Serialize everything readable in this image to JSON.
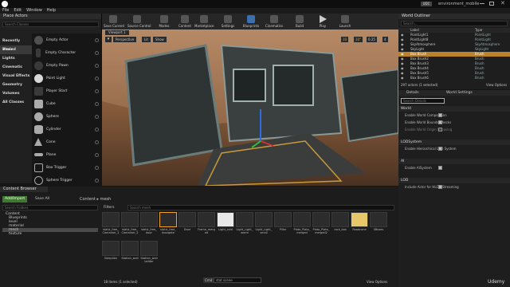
{
  "title_bar": {
    "project": "environment_mobile",
    "badge": "UDC"
  },
  "menu": [
    "File",
    "Edit",
    "Window",
    "Help"
  ],
  "place_actors": {
    "tab": "Place Actors",
    "search_placeholder": "Search Classes",
    "categories": [
      "Recently Placed",
      "Basic",
      "Lights",
      "Cinematic",
      "Visual Effects",
      "Geometry",
      "Volumes",
      "All Classes"
    ],
    "actors": [
      "Empty Actor",
      "Empty Character",
      "Empty Pawn",
      "Point Light",
      "Player Start",
      "Cube",
      "Sphere",
      "Cylinder",
      "Cone",
      "Plane",
      "Box Trigger",
      "Sphere Trigger"
    ]
  },
  "toolbar": [
    "Save Current",
    "Source Control",
    "Modes",
    "Content",
    "Marketplace",
    "Settings",
    "Blueprints",
    "Cinematics",
    "Build",
    "Play",
    "Launch"
  ],
  "viewport": {
    "tab": "Viewport 1",
    "mode": "Perspective",
    "lit": "Lit",
    "show": "Show",
    "grid": "10",
    "angle": "10°",
    "scale": "0.25",
    "cam": "4"
  },
  "outliner": {
    "title": "World Outliner",
    "search_placeholder": "Search...",
    "headers": [
      "Label",
      "Type"
    ],
    "rows": [
      {
        "label": "PointLight1",
        "type": "PointLight"
      },
      {
        "label": "PointLight8",
        "type": "PointLight"
      },
      {
        "label": "SkyAtmosphere",
        "type": "SkyAtmosphere"
      },
      {
        "label": "SkyLight",
        "type": "SkyLight"
      },
      {
        "label": "Box Brush",
        "type": "Brush"
      },
      {
        "label": "Box Brush2",
        "type": "Brush"
      },
      {
        "label": "Box Brush3",
        "type": "Brush"
      },
      {
        "label": "Box Brush4",
        "type": "Brush"
      },
      {
        "label": "Box Brush5",
        "type": "Brush"
      },
      {
        "label": "Box Brush6",
        "type": "Brush"
      }
    ],
    "count": "297 actors (1 selected)",
    "view_options": "View Options"
  },
  "details": {
    "tabs": [
      "Details",
      "World Settings"
    ],
    "search_placeholder": "Search Details",
    "sections": [
      {
        "name": "World",
        "props": [
          "Enable World Composition",
          "Enable World Bounds Checks",
          "Enable World Origin Rebasing"
        ]
      },
      {
        "name": "LODSystem",
        "props": [
          "Enable Hierarchical LOD System"
        ]
      },
      {
        "name": "AI",
        "props": [
          "Enable AISystem"
        ]
      },
      {
        "name": "LOD",
        "props": [
          "Include Actor for HLOD Streaming"
        ]
      }
    ]
  },
  "content_browser": {
    "tab": "Content Browser",
    "add_import": "Add/Import",
    "save_all": "Save All",
    "path": [
      "Content",
      "mesh"
    ],
    "search_folders": "Search Folders",
    "filters": "Filters",
    "search_mesh": "Search mesh",
    "folders": [
      "Content",
      "Blueprints",
      "level",
      "material",
      "mesh",
      "texture"
    ],
    "assets": [
      "static_free_Container_1",
      "static_free_Container_2",
      "static_free_door",
      "static_free_doorgate",
      "Door",
      "Frame_merged",
      "Light_cold",
      "Light_Light_warm",
      "Light_Light_small",
      "Pillar",
      "Plate_Plate_merged",
      "Plate_Plate_merged2",
      "rack_box",
      "Roadcone",
      "SBoxes",
      "Sidepillar",
      "Station_wall",
      "Station_wallladder"
    ],
    "items_count": "18 items (1 selected)",
    "view_options": "View Options",
    "cmd_label": "Cmd",
    "cmd_placeholder": "stat scene"
  },
  "watermark": "Udemy",
  "colors": {
    "accent": "#f0a12c",
    "selection": "#b9822b",
    "viewport_sky": "#a97a57"
  }
}
